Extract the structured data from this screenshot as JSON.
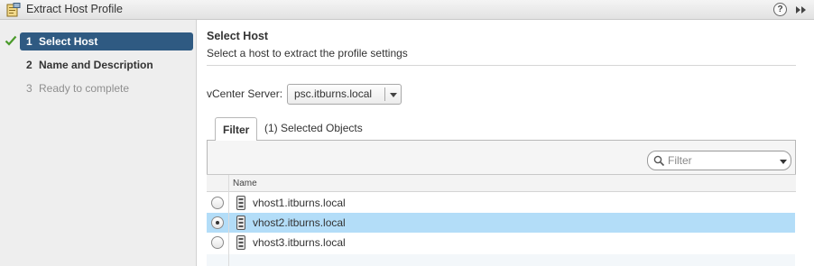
{
  "window": {
    "title": "Extract Host Profile",
    "help_glyph": "?"
  },
  "steps": [
    {
      "number": "1",
      "label": "Select Host",
      "state": "active",
      "completed": true
    },
    {
      "number": "2",
      "label": "Name and Description",
      "state": "normal",
      "completed": false
    },
    {
      "number": "3",
      "label": "Ready to complete",
      "state": "disabled",
      "completed": false
    }
  ],
  "main": {
    "title": "Select Host",
    "subtitle": "Select a host to extract the profile settings",
    "vcenter": {
      "label": "vCenter Server:",
      "value": "psc.itburns.local"
    },
    "tabs": [
      {
        "label": "Filter",
        "active": true
      },
      {
        "label": "(1) Selected Objects",
        "active": false
      }
    ],
    "filter": {
      "placeholder": "Filter"
    },
    "grid": {
      "column_header": "Name",
      "rows": [
        {
          "name": "vhost1.itburns.local",
          "selected": false
        },
        {
          "name": "vhost2.itburns.local",
          "selected": true
        },
        {
          "name": "vhost3.itburns.local",
          "selected": false
        }
      ]
    }
  },
  "colors": {
    "accent": "#2f5a82",
    "selection": "#b3ddf8",
    "check": "#4a9a2a",
    "sidebar_bg": "#eeeeee"
  },
  "icons": {
    "title": "extract-profile-icon",
    "help": "help-icon",
    "expand": "double-chevron-right-icon",
    "check": "checkmark-icon",
    "search": "search-icon",
    "host": "host-server-icon"
  }
}
